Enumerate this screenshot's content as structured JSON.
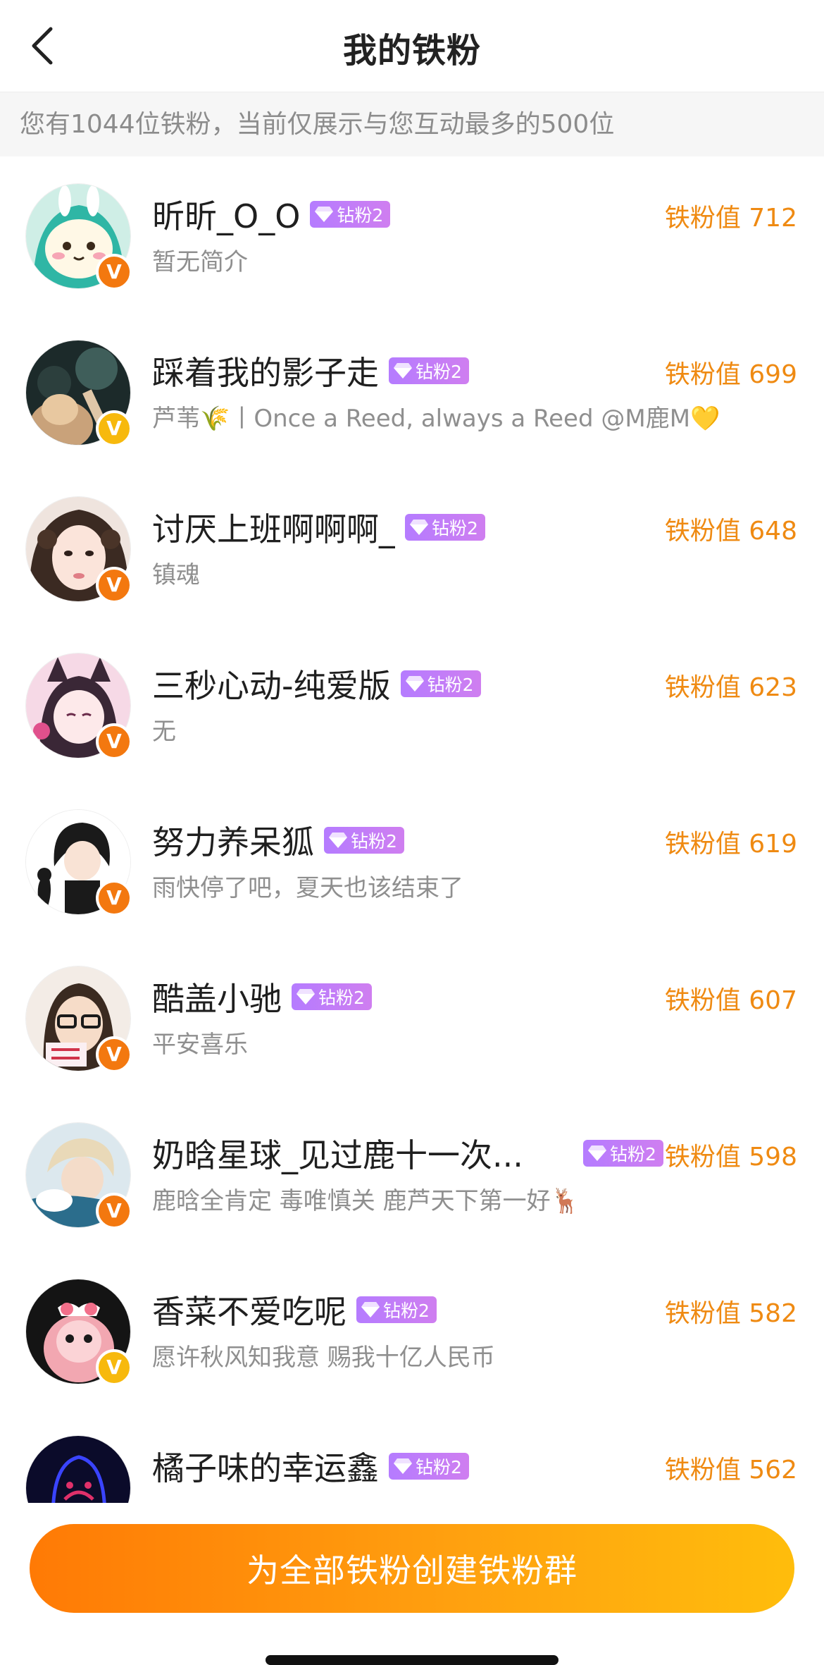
{
  "header": {
    "title": "我的铁粉"
  },
  "info": {
    "text": "您有1044位铁粉，当前仅展示与您互动最多的500位"
  },
  "fans": [
    {
      "name": "昕昕_O_O",
      "badge": "钻粉2",
      "value": "铁粉值 712",
      "bio": "暂无简介",
      "verify": "orange",
      "avatar": "anime-green-hair"
    },
    {
      "name": "踩着我的影子走",
      "badge": "钻粉2",
      "value": "铁粉值 699",
      "bio": "芦苇🌾丨Once a Reed, always a Reed @M鹿M💛",
      "verify": "gold",
      "avatar": "dark-photo"
    },
    {
      "name": "讨厌上班啊啊啊_",
      "badge": "钻粉2",
      "value": "铁粉值 648",
      "bio": "镇魂",
      "verify": "orange",
      "avatar": "curly-hair-girl"
    },
    {
      "name": "三秒心动-纯爱版",
      "badge": "钻粉2",
      "value": "铁粉值 623",
      "bio": "无",
      "verify": "orange",
      "avatar": "anime-cat-girl"
    },
    {
      "name": "努力养呆狐",
      "badge": "钻粉2",
      "value": "铁粉值 619",
      "bio": "雨快停了吧，夏天也该结束了",
      "verify": "orange",
      "avatar": "anime-boy-black"
    },
    {
      "name": "酷盖小驰",
      "badge": "钻粉2",
      "value": "铁粉值 607",
      "bio": "平安喜乐",
      "verify": "orange",
      "avatar": "girl-glasses"
    },
    {
      "name": "奶晗星球_见过鹿十一次...",
      "badge": "钻粉2",
      "value": "铁粉值 598",
      "bio": "鹿晗全肯定 毒唯慎关 鹿芦天下第一好🦌",
      "verify": "orange",
      "avatar": "blond-boy"
    },
    {
      "name": "香菜不爱吃呢",
      "badge": "钻粉2",
      "value": "铁粉值 582",
      "bio": "愿许秋风知我意 赐我十亿人民币",
      "verify": "gold",
      "avatar": "pink-bear"
    },
    {
      "name": "橘子味的幸运鑫",
      "badge": "钻粉2",
      "value": "铁粉值 562",
      "bio": "",
      "verify": "orange",
      "avatar": "neon-portrait"
    }
  ],
  "verify_label": "V",
  "colors": {
    "accent_orange": "#ef8a12",
    "verify_orange": "#f3780f",
    "verify_gold": "#f7b90d",
    "badge_purple": "#b57cff"
  },
  "footer": {
    "create_group_label": "为全部铁粉创建铁粉群"
  }
}
